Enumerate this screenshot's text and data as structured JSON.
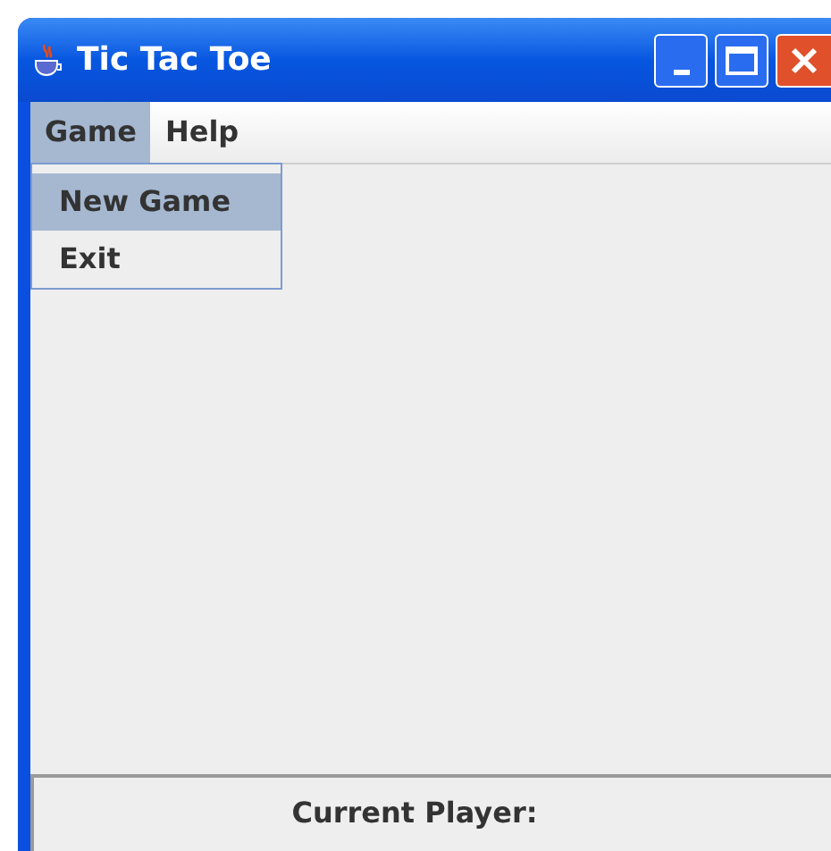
{
  "window": {
    "title": "Tic Tac Toe"
  },
  "menu_bar": [
    {
      "label": "Game",
      "selected": true
    },
    {
      "label": "Help",
      "selected": false
    }
  ],
  "dropdown": [
    {
      "label": "New Game",
      "selected": true
    },
    {
      "label": "Exit",
      "selected": false
    }
  ],
  "status_panel": {
    "label": "Current Player:"
  }
}
